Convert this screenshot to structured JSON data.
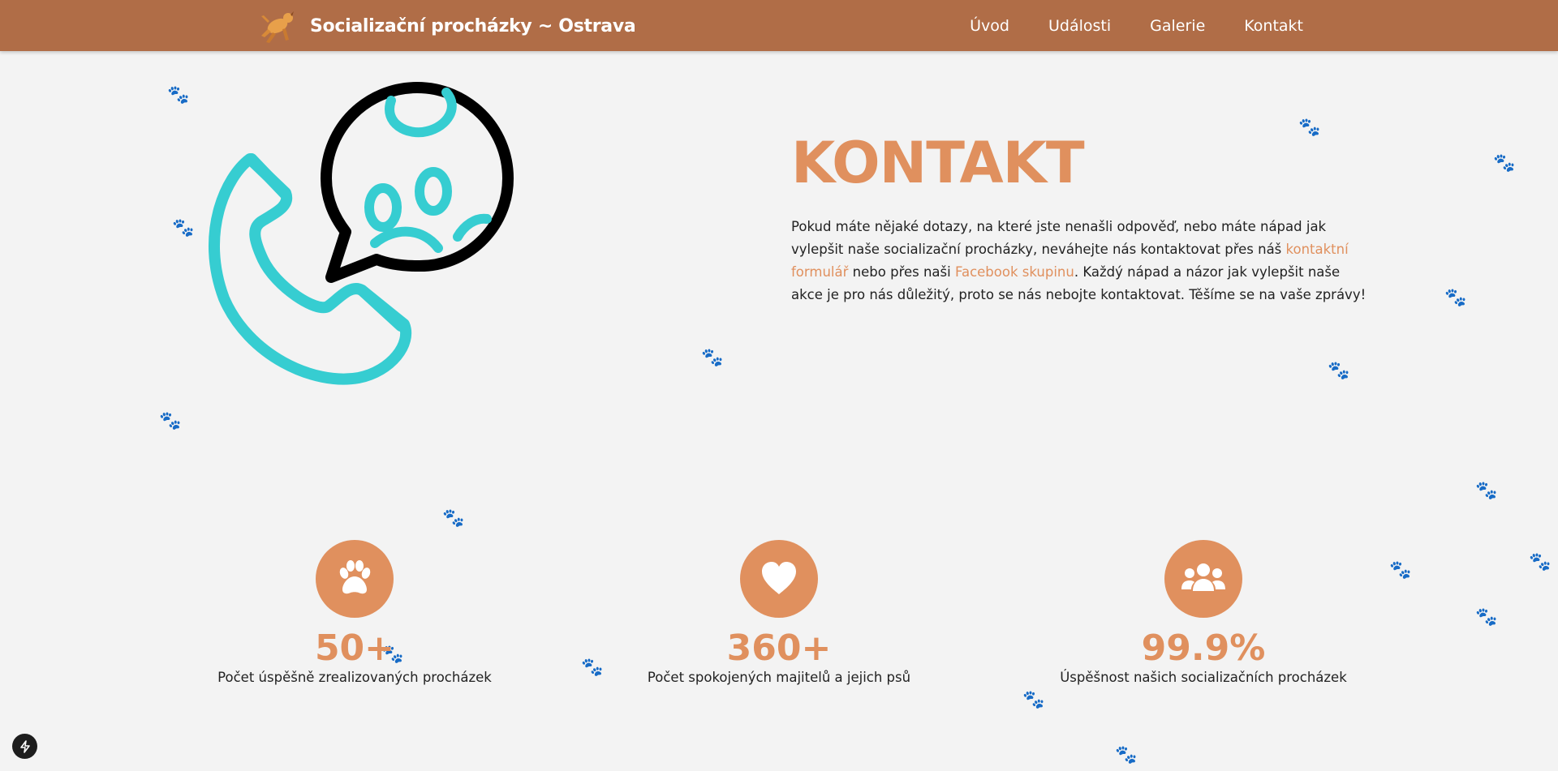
{
  "navbar": {
    "brand_title": "Socializační procházky ~ Ostrava",
    "logo_icon": "running-dog-icon",
    "links": [
      "Úvod",
      "Události",
      "Galerie",
      "Kontakt"
    ]
  },
  "hero": {
    "illustration_icon": "phone-paw-chat-icon",
    "title": "KONTAKT",
    "text_part1": "Pokud máte nějaké dotazy, na které jste nenašli odpověď, nebo máte nápad jak vylepšit naše socializační procházky, neváhejte nás kontaktovat přes náš ",
    "link_form": "kontaktní formulář",
    "text_part2": " nebo přes naši ",
    "link_facebook": "Facebook skupinu",
    "text_part3": ". Každý nápad a názor jak vylepšit naše akce je pro nás důležitý, proto se nás nebojte kontaktovat. Těšíme se na vaše zprávy!"
  },
  "stats": [
    {
      "icon": "paw-icon",
      "value": "50+",
      "label": "Počet úspěšně zrealizovaných procházek"
    },
    {
      "icon": "heart-icon",
      "value": "360+",
      "label": "Počet spokojených majitelů a jejich psů"
    },
    {
      "icon": "users-icon",
      "value": "99.9%",
      "label": "Úspěšnost našich socializačních procházek"
    }
  ],
  "colors": {
    "navbar": "#b06d47",
    "accent": "#e0905e",
    "teal": "#36cdd1",
    "background": "#f3f3f3"
  },
  "corner_badge_icon": "lightning-icon"
}
